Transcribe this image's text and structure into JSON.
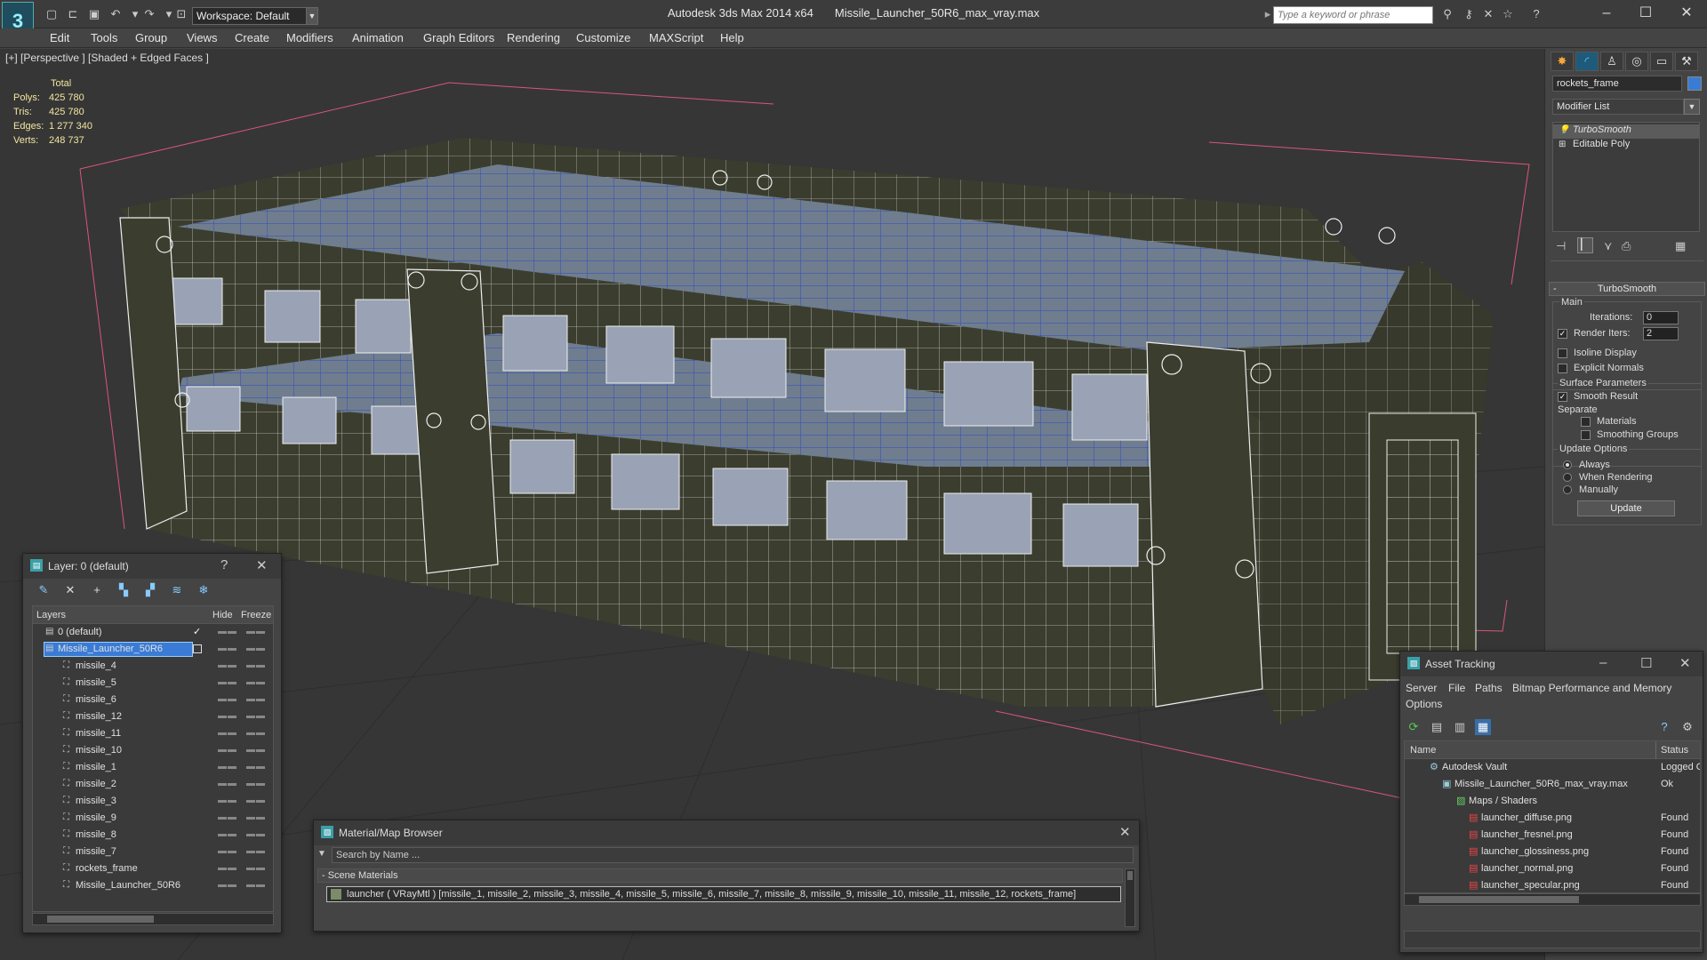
{
  "app": {
    "title": "Autodesk 3ds Max  2014 x64",
    "file": "Missile_Launcher_50R6_max_vray.max",
    "workspace": "Workspace: Default",
    "keyword_placeholder": "Type a keyword or phrase"
  },
  "menu": [
    "Edit",
    "Tools",
    "Group",
    "Views",
    "Create",
    "Modifiers",
    "Animation",
    "Graph Editors",
    "Rendering",
    "Customize",
    "MAXScript",
    "Help"
  ],
  "viewport": {
    "label": "[+] [Perspective ] [Shaded + Edged Faces ]",
    "stats": {
      "header": "Total",
      "rows": [
        {
          "k": "Polys:",
          "v": "425 780"
        },
        {
          "k": "Tris:",
          "v": "425 780"
        },
        {
          "k": "Edges:",
          "v": "1 277 340"
        },
        {
          "k": "Verts:",
          "v": "248 737"
        }
      ]
    }
  },
  "command_panel": {
    "object_name": "rockets_frame",
    "modifier_list": "Modifier List",
    "stack": [
      "TurboSmooth",
      "Editable Poly"
    ],
    "rollout_title": "TurboSmooth",
    "main": "Main",
    "iterations_label": "Iterations:",
    "iterations_value": "0",
    "render_iters_label": "Render Iters:",
    "render_iters_value": "2",
    "isoline": "Isoline Display",
    "explicit": "Explicit Normals",
    "surface": "Surface Parameters",
    "smooth_result": "Smooth Result",
    "separate": "Separate",
    "materials": "Materials",
    "smoothing_groups": "Smoothing Groups",
    "update_options": "Update Options",
    "always": "Always",
    "when_rendering": "When Rendering",
    "manually": "Manually",
    "update_btn": "Update"
  },
  "layer_window": {
    "title": "Layer: 0 (default)",
    "help": "?",
    "cols": {
      "layers": "Layers",
      "hide": "Hide",
      "freeze": "Freeze"
    },
    "items": [
      "0 (default)",
      "Missile_Launcher_50R6",
      "missile_4",
      "missile_5",
      "missile_6",
      "missile_12",
      "missile_11",
      "missile_10",
      "missile_1",
      "missile_2",
      "missile_3",
      "missile_9",
      "missile_8",
      "missile_7",
      "rockets_frame",
      "Missile_Launcher_50R6"
    ]
  },
  "material_browser": {
    "title": "Material/Map Browser",
    "search": "Search by Name ...",
    "section": "- Scene Materials",
    "item": "launcher  ( VRayMtl ) [missile_1, missile_2, missile_3, missile_4, missile_5, missile_6, missile_7, missile_8, missile_9, missile_10, missile_11, missile_12, rockets_frame]"
  },
  "asset_tracking": {
    "title": "Asset Tracking",
    "menu": [
      "Server",
      "File",
      "Paths",
      "Bitmap Performance and Memory"
    ],
    "options": "Options",
    "cols": {
      "name": "Name",
      "status": "Status"
    },
    "rows": [
      {
        "name": "Autodesk Vault",
        "status": "Logged O"
      },
      {
        "name": "Missile_Launcher_50R6_max_vray.max",
        "status": "Ok"
      },
      {
        "name": "Maps / Shaders",
        "status": ""
      },
      {
        "name": "launcher_diffuse.png",
        "status": "Found"
      },
      {
        "name": "launcher_fresnel.png",
        "status": "Found"
      },
      {
        "name": "launcher_glossiness.png",
        "status": "Found"
      },
      {
        "name": "launcher_normal.png",
        "status": "Found"
      },
      {
        "name": "launcher_specular.png",
        "status": "Found"
      }
    ]
  },
  "colors": {
    "accent": "#3a7bd5",
    "stats": "#f3e6a0",
    "wire": "#ffffff",
    "model": "#3a3d2e",
    "missile_blue": "#3350c8"
  }
}
